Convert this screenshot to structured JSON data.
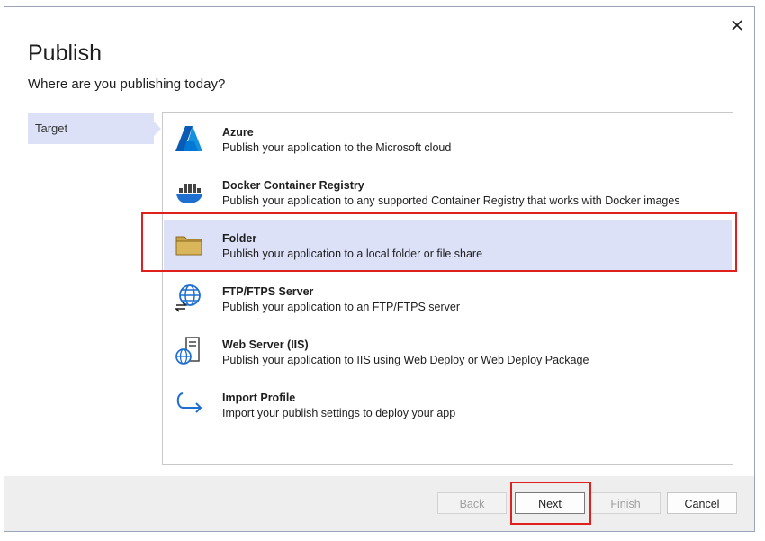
{
  "dialog": {
    "title": "Publish",
    "subtitle": "Where are you publishing today?"
  },
  "nav": {
    "items": [
      {
        "label": "Target",
        "selected": true
      }
    ]
  },
  "targets": [
    {
      "name": "Azure",
      "description": "Publish your application to the Microsoft cloud",
      "icon": "azure-icon"
    },
    {
      "name": "Docker Container Registry",
      "description": "Publish your application to any supported Container Registry that works with Docker images",
      "icon": "docker-icon"
    },
    {
      "name": "Folder",
      "description": "Publish your application to a local folder or file share",
      "icon": "folder-icon",
      "selected": true
    },
    {
      "name": "FTP/FTPS Server",
      "description": "Publish your application to an FTP/FTPS server",
      "icon": "ftp-globe-icon"
    },
    {
      "name": "Web Server (IIS)",
      "description": "Publish your application to IIS using Web Deploy or Web Deploy Package",
      "icon": "web-server-icon"
    },
    {
      "name": "Import Profile",
      "description": "Import your publish settings to deploy your app",
      "icon": "import-arrow-icon"
    }
  ],
  "buttons": {
    "back": "Back",
    "next": "Next",
    "finish": "Finish",
    "cancel": "Cancel"
  },
  "colors": {
    "selection": "#dde1f7",
    "annotation": "#e0201c",
    "accent": "#0078d4",
    "folder": "#c8a34a"
  }
}
